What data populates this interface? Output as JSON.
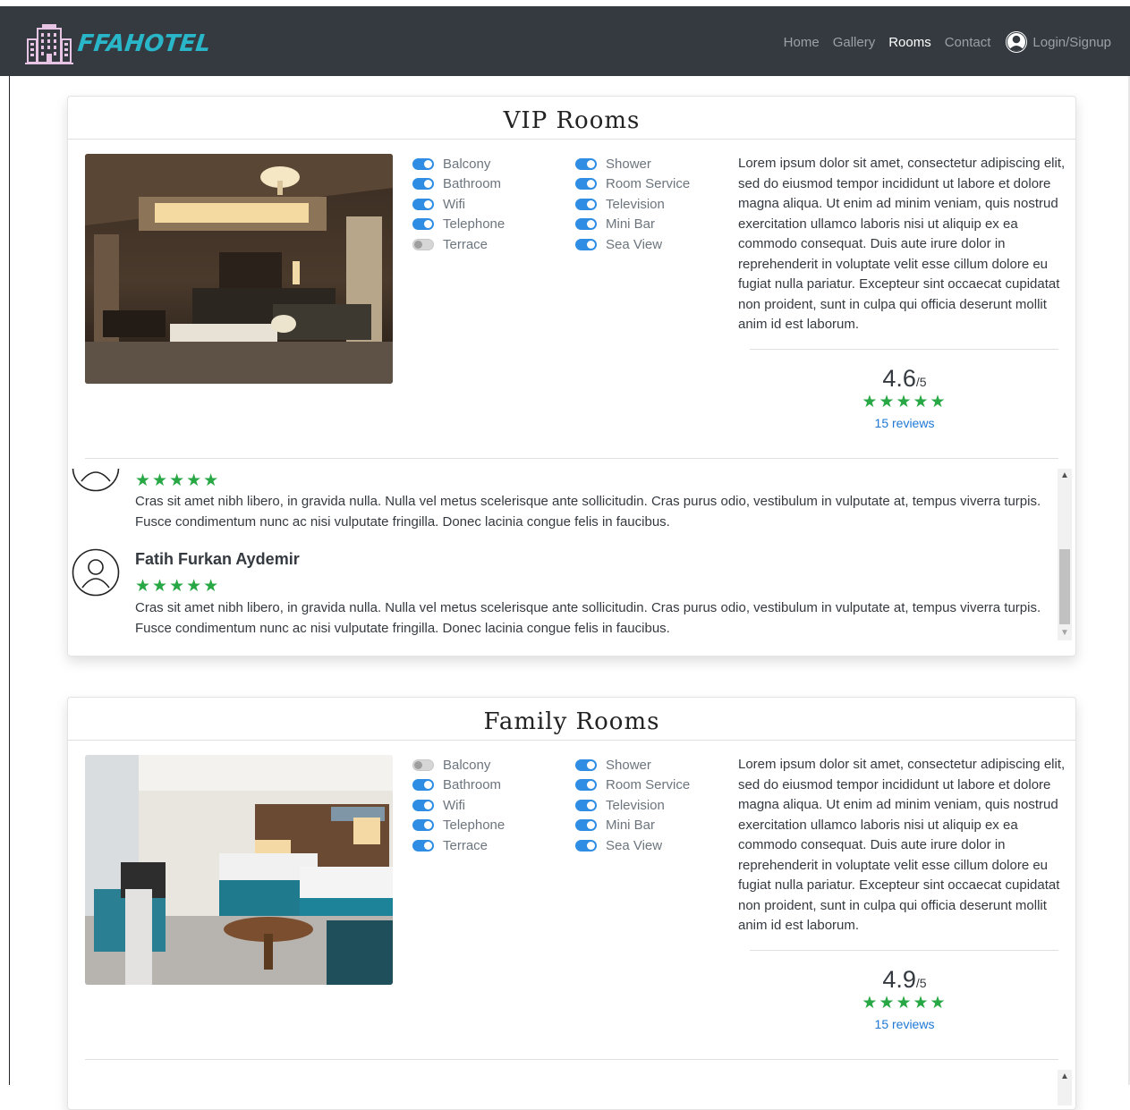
{
  "brand": {
    "name": "FFAHOTEL",
    "color": "#29b6c8"
  },
  "nav": {
    "links": [
      {
        "label": "Home"
      },
      {
        "label": "Gallery"
      },
      {
        "label": "Rooms",
        "active": true
      },
      {
        "label": "Contact"
      }
    ],
    "login_label": "Login/Signup"
  },
  "rooms": [
    {
      "title": "VIP Rooms",
      "amenities_left": [
        {
          "label": "Balcony",
          "enabled": true
        },
        {
          "label": "Bathroom",
          "enabled": true
        },
        {
          "label": "Wifi",
          "enabled": true
        },
        {
          "label": "Telephone",
          "enabled": true
        },
        {
          "label": "Terrace",
          "enabled": false
        }
      ],
      "amenities_right": [
        {
          "label": "Shower",
          "enabled": true
        },
        {
          "label": "Room Service",
          "enabled": true
        },
        {
          "label": "Television",
          "enabled": true
        },
        {
          "label": "Mini Bar",
          "enabled": true
        },
        {
          "label": "Sea View",
          "enabled": true
        }
      ],
      "description": "Lorem ipsum dolor sit amet, consectetur adipiscing elit, sed do eiusmod tempor incididunt ut labore et dolore magna aliqua. Ut enim ad minim veniam, quis nostrud exercitation ullamco laboris nisi ut aliquip ex ea commodo consequat. Duis aute irure dolor in reprehenderit in voluptate velit esse cillum dolore eu fugiat nulla pariatur. Excepteur sint occaecat cupidatat non proident, sunt in culpa qui officia deserunt mollit anim id est laborum.",
      "rating": "4.6",
      "rating_max": "/5",
      "stars": "★★★★★",
      "reviews_link": "15 reviews",
      "reviews": [
        {
          "stars": "★★★★★",
          "text": "Cras sit amet nibh libero, in gravida nulla. Nulla vel metus scelerisque ante sollicitudin. Cras purus odio, vestibulum in vulputate at, tempus viverra turpis. Fusce condimentum nunc ac nisi vulputate fringilla. Donec lacinia congue felis in faucibus."
        },
        {
          "name": "Fatih Furkan Aydemir",
          "stars": "★★★★★",
          "text": "Cras sit amet nibh libero, in gravida nulla. Nulla vel metus scelerisque ante sollicitudin. Cras purus odio, vestibulum in vulputate at, tempus viverra turpis. Fusce condimentum nunc ac nisi vulputate fringilla. Donec lacinia congue felis in faucibus."
        }
      ]
    },
    {
      "title": "Family Rooms",
      "amenities_left": [
        {
          "label": "Balcony",
          "enabled": false
        },
        {
          "label": "Bathroom",
          "enabled": true
        },
        {
          "label": "Wifi",
          "enabled": true
        },
        {
          "label": "Telephone",
          "enabled": true
        },
        {
          "label": "Terrace",
          "enabled": true
        }
      ],
      "amenities_right": [
        {
          "label": "Shower",
          "enabled": true
        },
        {
          "label": "Room Service",
          "enabled": true
        },
        {
          "label": "Television",
          "enabled": true
        },
        {
          "label": "Mini Bar",
          "enabled": true
        },
        {
          "label": "Sea View",
          "enabled": true
        }
      ],
      "description": "Lorem ipsum dolor sit amet, consectetur adipiscing elit, sed do eiusmod tempor incididunt ut labore et dolore magna aliqua. Ut enim ad minim veniam, quis nostrud exercitation ullamco laboris nisi ut aliquip ex ea commodo consequat. Duis aute irure dolor in reprehenderit in voluptate velit esse cillum dolore eu fugiat nulla pariatur. Excepteur sint occaecat cupidatat non proident, sunt in culpa qui officia deserunt mollit anim id est laborum.",
      "rating": "4.9",
      "rating_max": "/5",
      "stars": "★★★★★",
      "reviews_link": "15 reviews"
    }
  ],
  "colors": {
    "toggle_on": "#2f8de4",
    "star": "#28a745",
    "link": "#1e78d6",
    "navbar": "#343a40"
  }
}
